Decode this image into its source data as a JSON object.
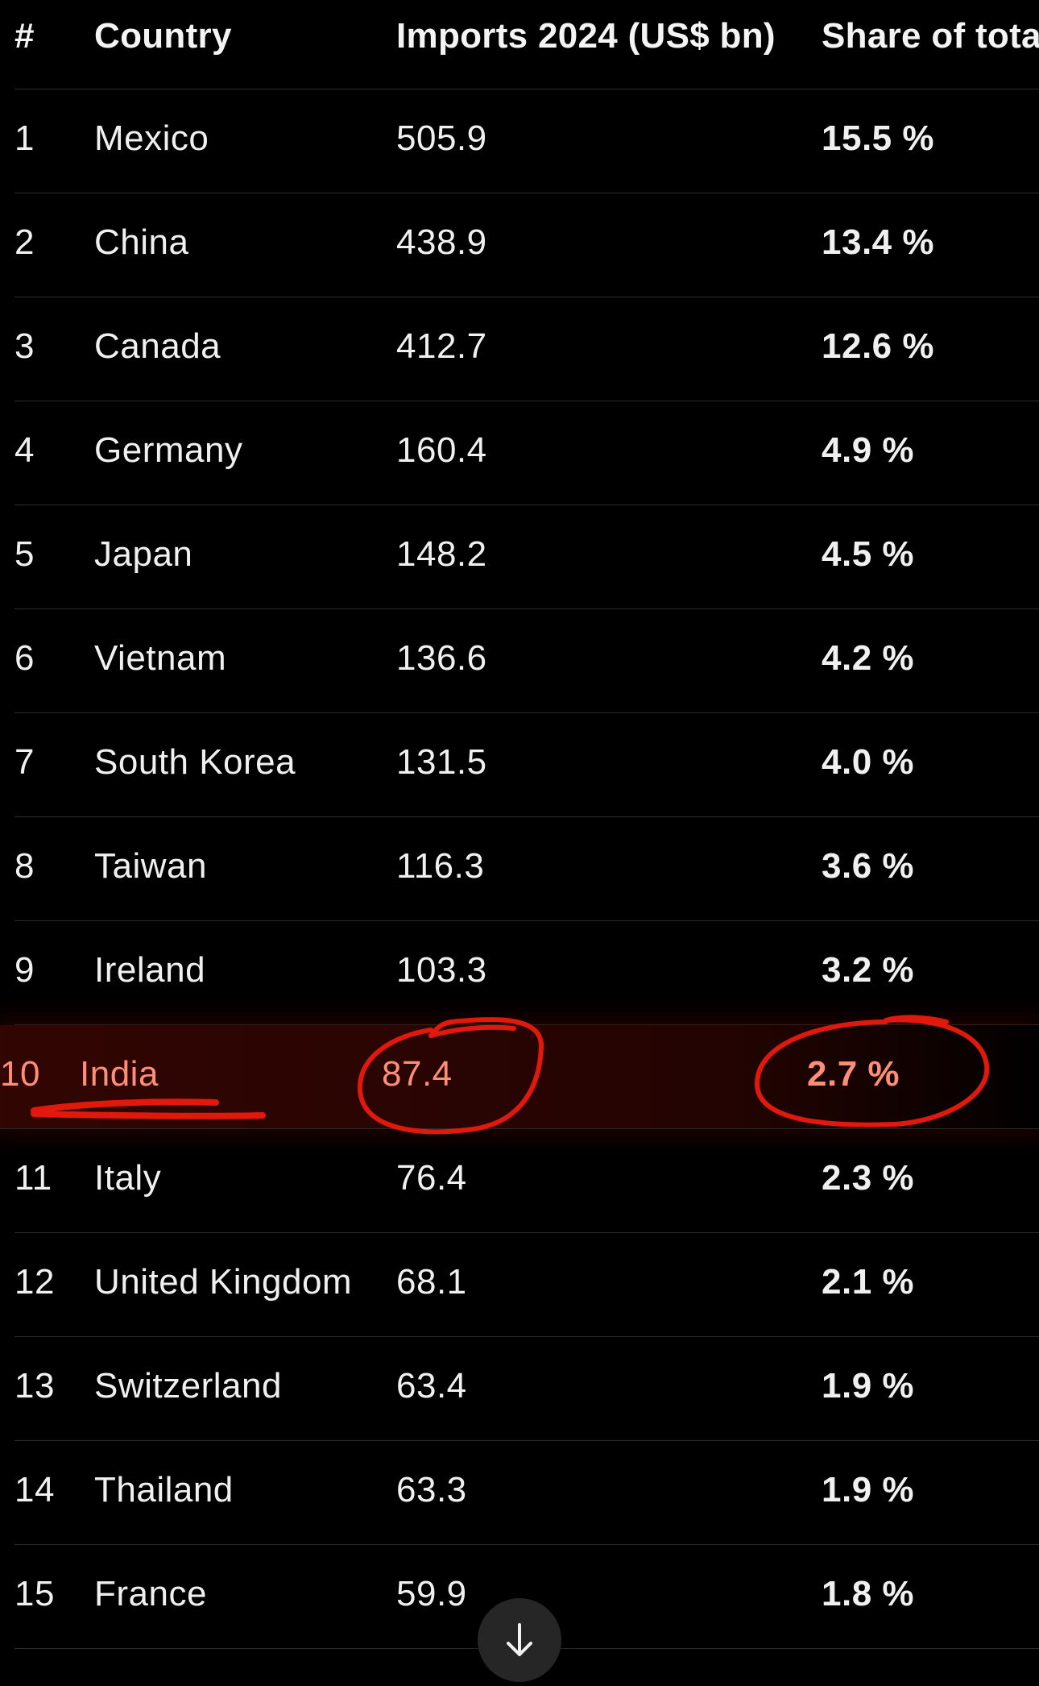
{
  "table": {
    "columns": [
      "#",
      "Country",
      "Imports 2024 (US$ bn)",
      "Share of tota"
    ],
    "rows": [
      {
        "rank": "1",
        "country": "Mexico",
        "imports": "505.9",
        "share": "15.5 %"
      },
      {
        "rank": "2",
        "country": "China",
        "imports": "438.9",
        "share": "13.4 %"
      },
      {
        "rank": "3",
        "country": "Canada",
        "imports": "412.7",
        "share": "12.6 %"
      },
      {
        "rank": "4",
        "country": "Germany",
        "imports": "160.4",
        "share": "4.9 %"
      },
      {
        "rank": "5",
        "country": "Japan",
        "imports": "148.2",
        "share": "4.5 %"
      },
      {
        "rank": "6",
        "country": "Vietnam",
        "imports": "136.6",
        "share": "4.2 %"
      },
      {
        "rank": "7",
        "country": "South Korea",
        "imports": "131.5",
        "share": "4.0 %"
      },
      {
        "rank": "8",
        "country": "Taiwan",
        "imports": "116.3",
        "share": "3.6 %"
      },
      {
        "rank": "9",
        "country": "Ireland",
        "imports": "103.3",
        "share": "3.2 %"
      },
      {
        "rank": "10",
        "country": "India",
        "imports": "87.4",
        "share": "2.7 %"
      },
      {
        "rank": "11",
        "country": "Italy",
        "imports": "76.4",
        "share": "2.3 %"
      },
      {
        "rank": "12",
        "country": "United Kingdom",
        "imports": "68.1",
        "share": "2.1 %"
      },
      {
        "rank": "13",
        "country": "Switzerland",
        "imports": "63.4",
        "share": "1.9 %"
      },
      {
        "rank": "14",
        "country": "Thailand",
        "imports": "63.3",
        "share": "1.9 %"
      },
      {
        "rank": "15",
        "country": "France",
        "imports": "59.9",
        "share": "1.8 %"
      }
    ],
    "highlighted_rank": "10"
  },
  "annotation": {
    "color": "#e0190c"
  },
  "scroll_button": {
    "icon": "arrow-down-icon"
  }
}
